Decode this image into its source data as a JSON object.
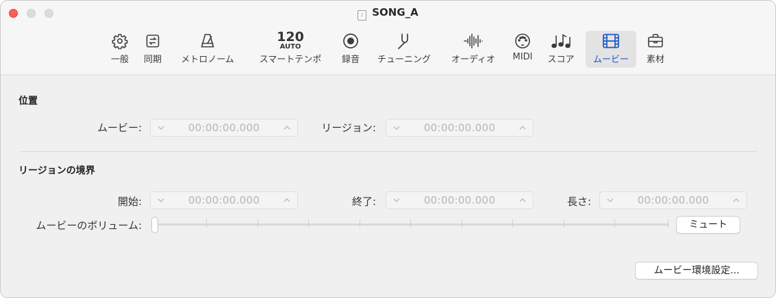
{
  "window": {
    "title": "SONG_A"
  },
  "toolbar": {
    "items": [
      {
        "label": "一般",
        "icon": "gear-icon"
      },
      {
        "label": "同期",
        "icon": "sync-icon"
      },
      {
        "label": "メトロノーム",
        "icon": "metronome-icon"
      },
      {
        "label": "スマートテンポ",
        "tempo": "120",
        "mode": "AUTO"
      },
      {
        "label": "録音",
        "icon": "record-icon"
      },
      {
        "label": "チューニング",
        "icon": "tuning-fork-icon"
      },
      {
        "label": "オーディオ",
        "icon": "waveform-icon"
      },
      {
        "label": "MIDI",
        "icon": "midi-port-icon"
      },
      {
        "label": "スコア",
        "icon": "score-notes-icon"
      },
      {
        "label": "ムービー",
        "icon": "film-icon",
        "selected": true
      },
      {
        "label": "素材",
        "icon": "briefcase-icon"
      }
    ],
    "selected_color": "#1a57c9"
  },
  "position": {
    "title": "位置",
    "movie_label": "ムービー:",
    "movie_value": "00:00:00.000",
    "region_label": "リージョン:",
    "region_value": "00:00:00.000"
  },
  "region_bounds": {
    "title": "リージョンの境界",
    "start_label": "開始:",
    "start_value": "00:00:00.000",
    "end_label": "終了:",
    "end_value": "00:00:00.000",
    "length_label": "長さ:",
    "length_value": "00:00:00.000",
    "volume_label": "ムービーのボリューム:",
    "volume_level": 0,
    "mute_label": "ミュート"
  },
  "footer": {
    "prefs_button": "ムービー環境設定..."
  }
}
